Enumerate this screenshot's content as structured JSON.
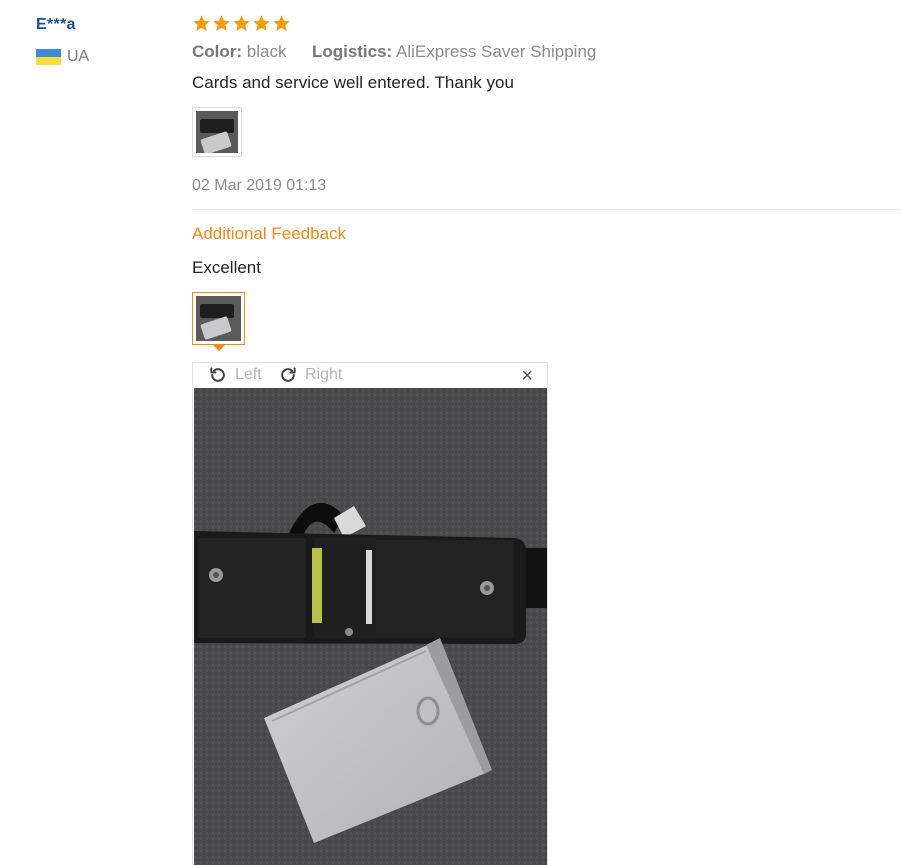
{
  "user": {
    "name": "E***a",
    "country": "UA",
    "flag_colors": [
      "#3d8bd6",
      "#f5de3a"
    ]
  },
  "review": {
    "rating": 5,
    "star_color": "#f39c12",
    "color_label": "Color:",
    "color_value": "black",
    "logistics_label": "Logistics:",
    "logistics_value": "AliExpress Saver Shipping",
    "text": "Cards and service well entered. Thank you",
    "date": "02 Mar 2019 01:13"
  },
  "additional": {
    "title": "Additional Feedback",
    "text": "Excellent",
    "accent_color": "#e8891a"
  },
  "viewer": {
    "rotate_left_label": "Left",
    "rotate_right_label": "Right",
    "close_icon": "close-icon",
    "close_glyph": "×"
  }
}
